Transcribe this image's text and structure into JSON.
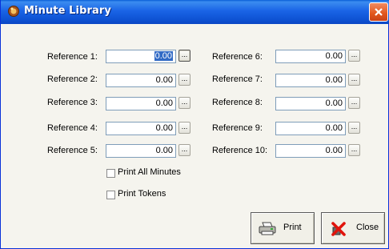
{
  "window": {
    "title": "Minute Library"
  },
  "icons": {
    "app": "app-icon",
    "close": "close-icon",
    "print": "printer-icon",
    "cancel": "red-x-icon"
  },
  "colors": {
    "titlebar": "#1a64e6",
    "close_button": "#e2561c",
    "selection": "#316ac5"
  },
  "references_left": [
    {
      "label": "Reference 1:",
      "value": "0.00",
      "selected": true
    },
    {
      "label": "Reference 2:",
      "value": "0.00"
    },
    {
      "label": "Reference 3:",
      "value": "0.00"
    },
    {
      "label": "Reference 4:",
      "value": "0.00"
    },
    {
      "label": "Reference 5:",
      "value": "0.00"
    }
  ],
  "references_right": [
    {
      "label": "Reference 6:",
      "value": "0.00"
    },
    {
      "label": "Reference 7:",
      "value": "0.00"
    },
    {
      "label": "Reference 8:",
      "value": "0.00"
    },
    {
      "label": "Reference 9:",
      "value": "0.00"
    },
    {
      "label": "Reference 10:",
      "value": "0.00"
    }
  ],
  "browse_label": "...",
  "options": {
    "print_all_minutes": {
      "label": "Print All Minutes",
      "checked": false
    },
    "print_tokens": {
      "label": "Print Tokens",
      "checked": false
    }
  },
  "buttons": {
    "print": "Print",
    "close": "Close"
  }
}
